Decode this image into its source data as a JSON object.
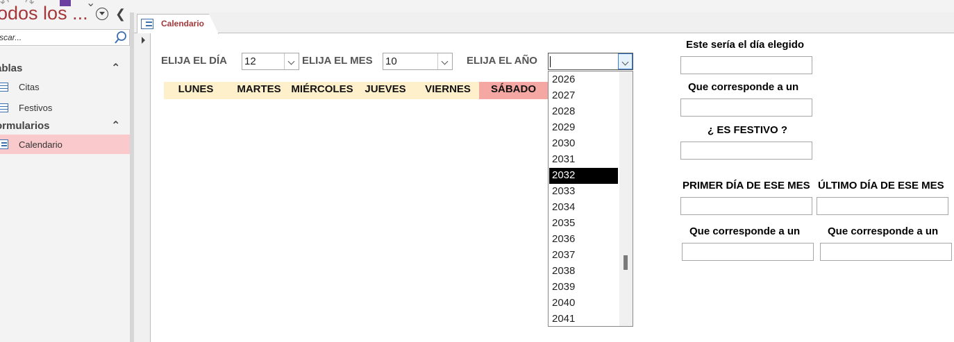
{
  "nav": {
    "title": "odos los ...",
    "search_placeholder": "scar...",
    "groups": [
      {
        "label": "ablas",
        "items": [
          "Citas",
          "Festivos"
        ]
      },
      {
        "label": "ormularios",
        "items": [
          "Calendario"
        ]
      }
    ]
  },
  "tab": {
    "label": "Calendario"
  },
  "form": {
    "day_label": "ELIJA EL DÍA",
    "day_value": "12",
    "month_label": "ELIJA EL MES",
    "month_value": "10",
    "year_label": "ELIJA EL AÑO",
    "year_value": "",
    "weekdays": [
      "LUNES",
      "MARTES",
      "MIÉRCOLES",
      "JUEVES",
      "VIERNES",
      "SÁBADO"
    ],
    "year_options": [
      "2026",
      "2027",
      "2028",
      "2029",
      "2030",
      "2031",
      "2032",
      "2033",
      "2034",
      "2035",
      "2036",
      "2037",
      "2038",
      "2039",
      "2040",
      "2041"
    ],
    "year_selected": "2032"
  },
  "panel": {
    "chosen_day_label": "Este sería el día elegido",
    "corresponds_label": "Que corresponde a un",
    "holiday_label": "¿ ES FESTIVO ?",
    "first_day_label": "PRIMER DÍA DE ESE MES",
    "last_day_label": "ÚLTIMO DÍA DE ESE MES",
    "first_corresponds_label": "Que corresponde a un",
    "last_corresponds_label": "Que corresponde a un"
  },
  "colors": {
    "accent": "#a4373a",
    "weekday_band": "#fff0cc",
    "saturday": "#f4a7a3",
    "selected_nav": "#f9c9cb"
  }
}
